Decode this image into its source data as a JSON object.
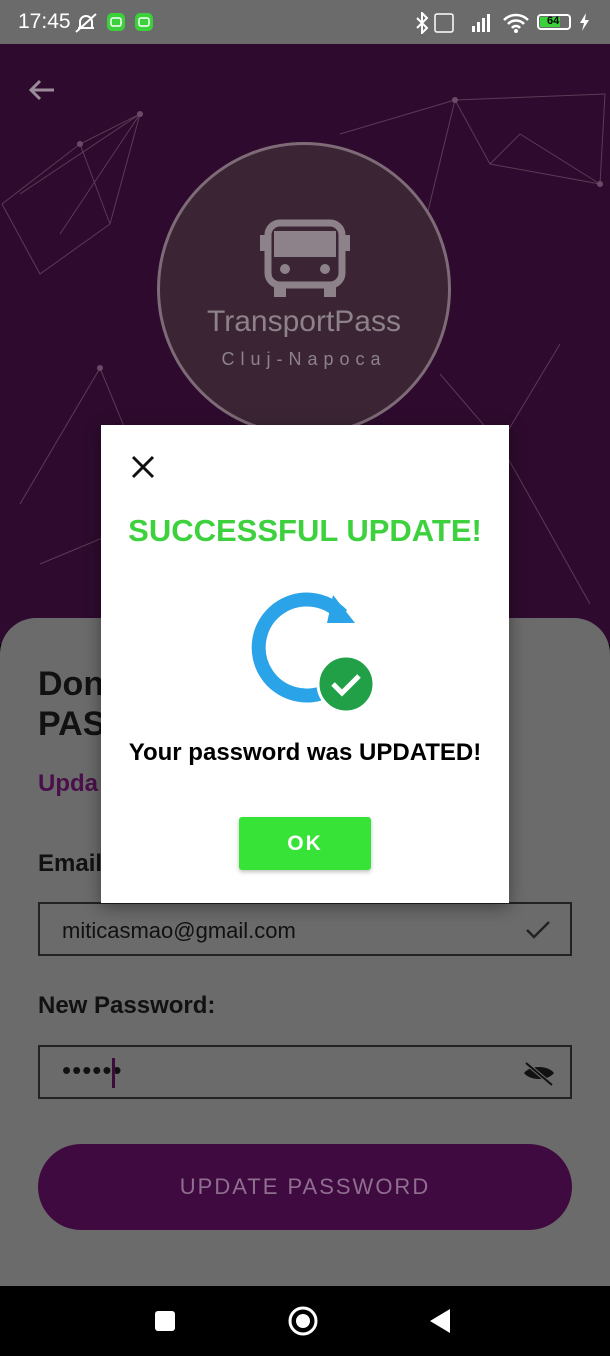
{
  "status_bar": {
    "time": "17:45",
    "battery": "64"
  },
  "header": {
    "logo_title": "TransportPass",
    "logo_subtitle": "Cluj-Napoca"
  },
  "sheet": {
    "title_partial": "Don\nPAS",
    "subtitle_partial": "Upda",
    "email_label_partial": "Email",
    "email_value": "miticasmao@gmail.com",
    "new_password_label": "New Password:",
    "password_value": "••••••",
    "update_button": "UPDATE PASSWORD"
  },
  "dialog": {
    "title": "SUCCESSFUL UPDATE!",
    "message": "Your password was UPDATED!",
    "ok_label": "OK"
  },
  "colors": {
    "accent": "#3ed13e",
    "brand": "#2e0b2e",
    "button": "#36e336"
  }
}
